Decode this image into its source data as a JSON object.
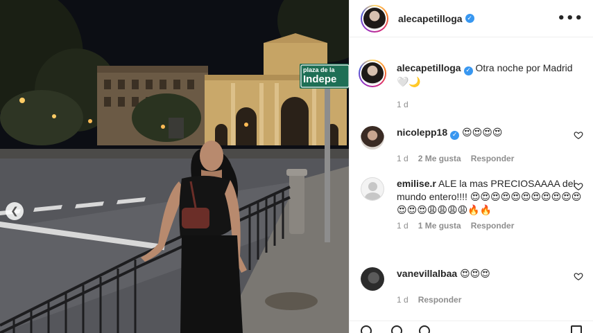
{
  "post": {
    "username": "alecapetilloga",
    "verified": true,
    "caption": "Otra noche por Madrid",
    "caption_emojis": "🤍🌙",
    "time": "1 d"
  },
  "street_sign": {
    "line1": "plaza de la",
    "line2": "Indepe"
  },
  "comments": [
    {
      "username": "nicolepp18",
      "verified": true,
      "text": "😍😍😍😍",
      "time": "1 d",
      "likes": "2 Me gusta",
      "reply": "Responder"
    },
    {
      "username": "emilise.r",
      "verified": false,
      "text": "ALE la mas PRECIOSAAAA del mundo entero!!!! 😍😍😍😍😍😍😍😍😍😍😍😍😍😍😩😩😩😩🔥🔥",
      "time": "1 d",
      "likes": "1 Me gusta",
      "reply": "Responder"
    },
    {
      "username": "vanevillalbaa",
      "verified": false,
      "text": "😍😍😍",
      "time": "1 d",
      "likes": "",
      "reply": "Responder"
    }
  ],
  "icons": {
    "more": "more-options-icon",
    "heart": "heart-icon",
    "verified": "verified-badge-icon",
    "prev": "chevron-left-icon"
  },
  "colors": {
    "verified": "#3897f0",
    "text": "#262626",
    "muted": "#8e8e8e"
  }
}
